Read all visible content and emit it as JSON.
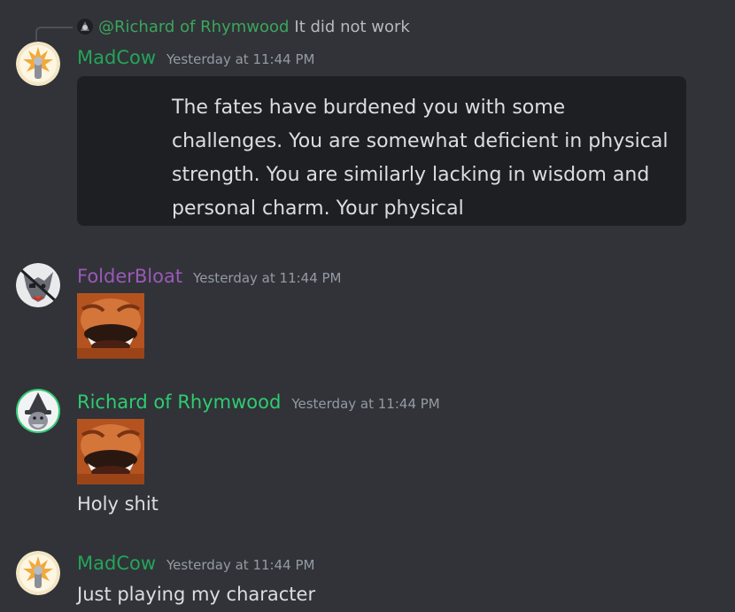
{
  "reply": {
    "mention": "@Richard of Rhymwood",
    "text": "It did not work"
  },
  "messages": [
    {
      "author": "MadCow",
      "author_color": "#23a559",
      "timestamp": "Yesterday at 11:44 PM",
      "embed_text": "The fates have burdened you with some challenges. You are somewhat deficient in physical strength. You are similarly lacking in wisdom and personal charm. Your physical"
    },
    {
      "author": "FolderBloat",
      "author_color": "#9b59b6",
      "timestamp": "Yesterday at 11:44 PM",
      "attachment": "laughing-face-sticker"
    },
    {
      "author": "Richard of Rhymwood",
      "author_color": "#2ecc71",
      "timestamp": "Yesterday at 11:44 PM",
      "attachment": "laughing-face-sticker",
      "text": "Holy shit"
    },
    {
      "author": "MadCow",
      "author_color": "#23a559",
      "timestamp": "Yesterday at 11:44 PM",
      "text": "Just playing my character"
    }
  ],
  "colors": {
    "background": "#313338",
    "embed_background": "#1e1f22",
    "timestamp": "#949ba4",
    "mention": "#3ba55d"
  }
}
